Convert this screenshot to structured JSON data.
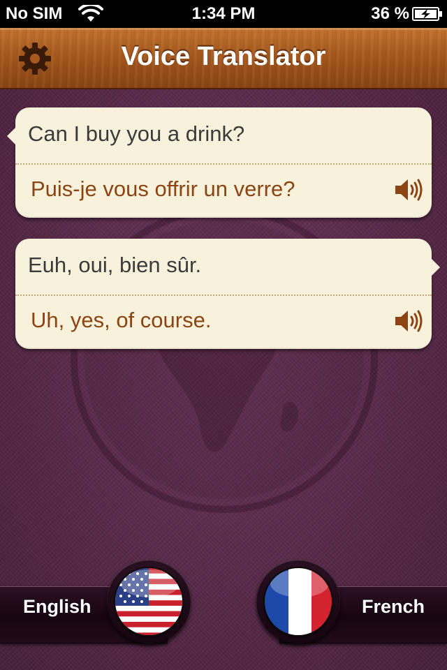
{
  "status_bar": {
    "carrier": "No SIM",
    "time": "1:34 PM",
    "battery_percent": "36 %"
  },
  "nav": {
    "title": "Voice Translator",
    "settings_icon": "gear-icon"
  },
  "conversation": [
    {
      "source_text": "Can I buy you a drink?",
      "translated_text": "Puis-je vous offrir un verre?",
      "side": "left",
      "speaker_icon": "speaker-icon"
    },
    {
      "source_text": "Euh, oui, bien sûr.",
      "translated_text": "Uh, yes, of course.",
      "side": "right",
      "speaker_icon": "speaker-icon"
    }
  ],
  "languages": {
    "left": {
      "label": "English",
      "flag_icon": "us-flag-icon"
    },
    "right": {
      "label": "French",
      "flag_icon": "france-flag-icon"
    }
  },
  "colors": {
    "nav_wood": "#a85a1e",
    "background_purple": "#552746",
    "bubble_cream": "#f8f2dc",
    "translation_brown": "#8c4413"
  }
}
